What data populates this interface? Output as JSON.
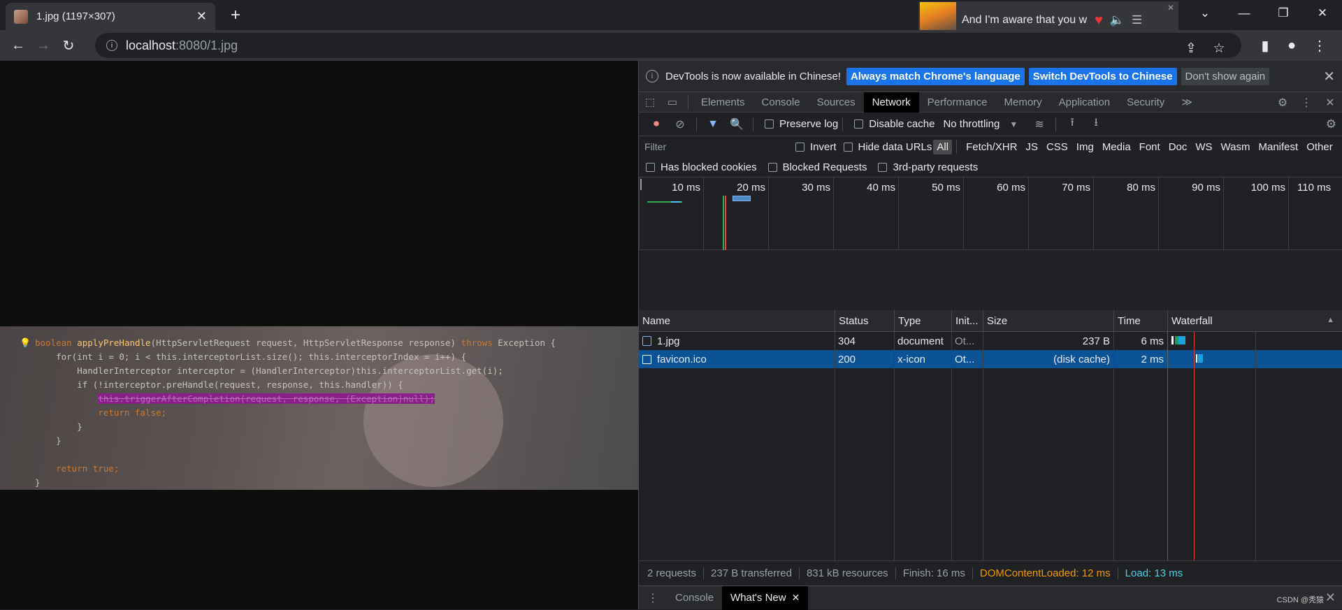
{
  "browser": {
    "tab_title": "1.jpg (1197×307)",
    "new_tab": "+",
    "url_host": "localhost",
    "url_path": ":8080/1.jpg"
  },
  "media": {
    "title": "And I'm aware that you w"
  },
  "code": {
    "line1_a": "boolean ",
    "line1_fn": "applyPreHandle",
    "line1_b": "(HttpServletRequest request, HttpServletResponse response) ",
    "line1_kw": "throws",
    "line1_c": " Exception {",
    "line2": "    for(int i = 0; i < this.interceptorList.size(); this.interceptorIndex = i++) {",
    "line3": "        HandlerInterceptor interceptor = (HandlerInterceptor)this.interceptorList.get(i);",
    "line4": "        if (!interceptor.preHandle(request, response, this.handler)) {",
    "line5": "this.triggerAfterCompletion(request, response, (Exception)null);",
    "line6": "            return false;",
    "line7": "        }",
    "line8": "    }",
    "line9": "",
    "line10": "    return true;",
    "line11": "}"
  },
  "devtools": {
    "banner": {
      "message": "DevTools is now available in Chinese!",
      "btn_match": "Always match Chrome's language",
      "btn_switch": "Switch DevTools to Chinese",
      "btn_dont": "Don't show again"
    },
    "tabs": [
      "Elements",
      "Console",
      "Sources",
      "Network",
      "Performance",
      "Memory",
      "Application",
      "Security"
    ],
    "more_tabs": "≫",
    "toolbar": {
      "preserve_log": "Preserve log",
      "disable_cache": "Disable cache",
      "throttling": "No throttling"
    },
    "filter": {
      "placeholder": "Filter",
      "invert": "Invert",
      "hide_data_urls": "Hide data URLs",
      "types": [
        "All",
        "Fetch/XHR",
        "JS",
        "CSS",
        "Img",
        "Media",
        "Font",
        "Doc",
        "WS",
        "Wasm",
        "Manifest",
        "Other"
      ]
    },
    "blocked": {
      "has_blocked_cookies": "Has blocked cookies",
      "blocked_requests": "Blocked Requests",
      "third_party": "3rd-party requests"
    },
    "overview_ticks": [
      "10 ms",
      "20 ms",
      "30 ms",
      "40 ms",
      "50 ms",
      "60 ms",
      "70 ms",
      "80 ms",
      "90 ms",
      "100 ms",
      "110 ms"
    ],
    "columns": [
      "Name",
      "Status",
      "Type",
      "Init...",
      "Size",
      "Time",
      "Waterfall"
    ],
    "rows": [
      {
        "name": "1.jpg",
        "status": "304",
        "type": "document",
        "initiator": "Ot...",
        "size": "237 B",
        "time": "6 ms"
      },
      {
        "name": "favicon.ico",
        "status": "200",
        "type": "x-icon",
        "initiator": "Ot...",
        "size": "(disk cache)",
        "time": "2 ms"
      }
    ],
    "status": {
      "requests": "2 requests",
      "transferred": "237 B transferred",
      "resources": "831 kB resources",
      "finish": "Finish: 16 ms",
      "dom": "DOMContentLoaded: 12 ms",
      "load": "Load: 13 ms"
    },
    "drawer": {
      "console": "Console",
      "whats_new": "What's New"
    }
  },
  "watermark": "CSDN @秃猿"
}
